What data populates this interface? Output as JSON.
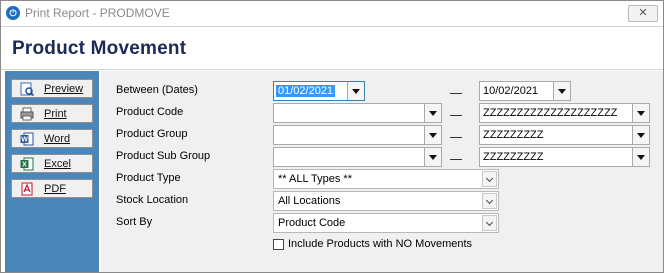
{
  "window": {
    "title": "Print Report - PRODMOVE",
    "close_glyph": "✕",
    "app_icon_glyph": "⏻"
  },
  "header": {
    "title": "Product Movement"
  },
  "sidebar": {
    "items": [
      {
        "label": "Preview",
        "icon": "preview-icon"
      },
      {
        "label": "Print",
        "icon": "printer-icon"
      },
      {
        "label": "Word",
        "icon": "word-icon"
      },
      {
        "label": "Excel",
        "icon": "excel-icon"
      },
      {
        "label": "PDF",
        "icon": "pdf-icon"
      }
    ]
  },
  "form": {
    "dates": {
      "label": "Between (Dates)",
      "from": "01/02/2021",
      "to": "10/02/2021"
    },
    "product_code": {
      "label": "Product Code",
      "from": "",
      "to": "ZZZZZZZZZZZZZZZZZZZZ"
    },
    "product_group": {
      "label": "Product Group",
      "from": "",
      "to": "ZZZZZZZZZ"
    },
    "product_sub_group": {
      "label": "Product Sub Group",
      "from": "",
      "to": "ZZZZZZZZZ"
    },
    "product_type": {
      "label": "Product Type",
      "value": "** ALL Types **"
    },
    "stock_location": {
      "label": "Stock Location",
      "value": "All Locations"
    },
    "sort_by": {
      "label": "Sort By",
      "value": "Product Code"
    },
    "include_no_movements": {
      "label": "Include Products with NO Movements",
      "checked": false
    }
  },
  "colors": {
    "sidebar_bg": "#4b86bb",
    "title_color": "#1b2b57",
    "selection": "#3399ff"
  }
}
